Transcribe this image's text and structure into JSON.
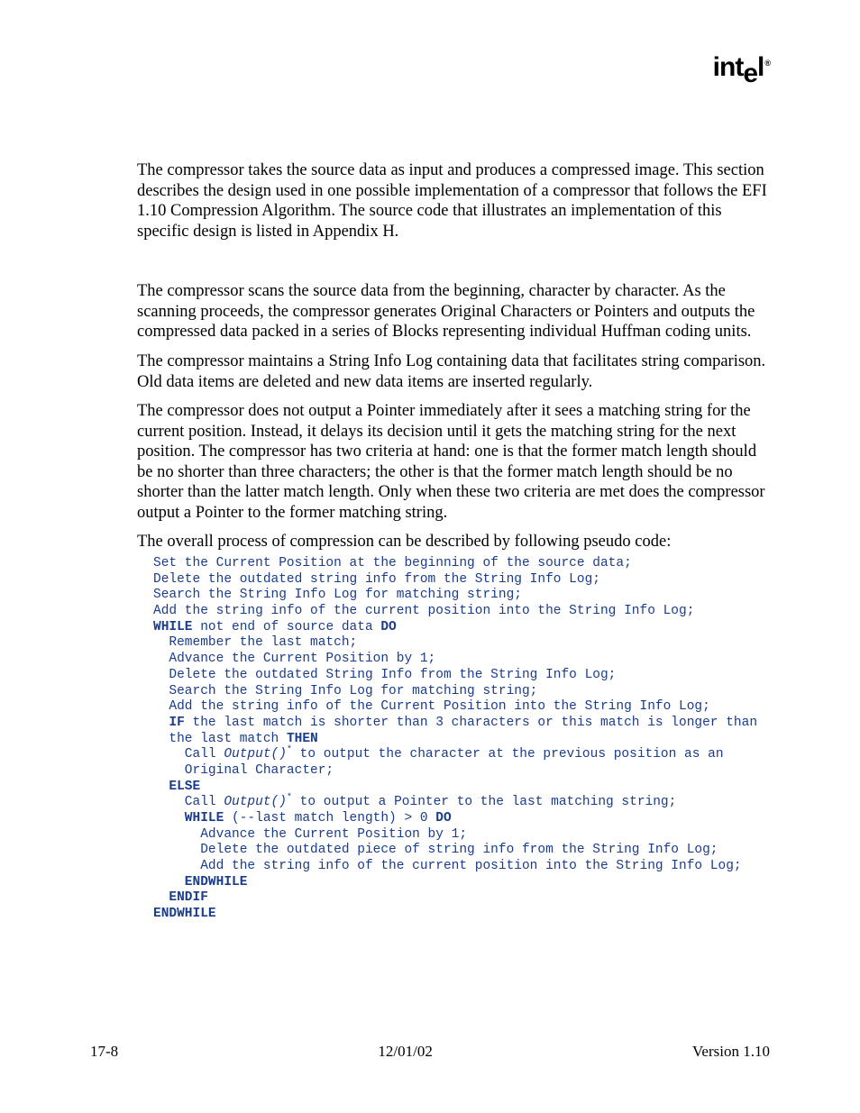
{
  "logo": {
    "text": "intel",
    "registered": "®"
  },
  "paragraphs": {
    "p1": "The compressor takes the source data as input and produces a compressed image.  This section describes the design used in one possible implementation of a compressor that follows the EFI 1.10 Compression Algorithm.  The source code that illustrates an implementation of this specific design is listed in Appendix H.",
    "p2": "The compressor scans the source data from the beginning, character by character.  As the scanning proceeds, the compressor generates Original Characters or Pointers and outputs the compressed data packed in a series of Blocks representing individual Huffman coding units.",
    "p3": "The compressor maintains a String Info Log containing data that facilitates string comparison.  Old data items are deleted and new data items are inserted regularly.",
    "p4": "The compressor does not output a Pointer immediately after it sees a matching string for the current position.  Instead, it delays its decision until it gets the matching string for the next position.  The compressor has two criteria at hand: one is that the former match length should be no shorter than three characters; the other is that the former match length should be no shorter than the latter match length.  Only when these two criteria are met does the compressor output a Pointer to the former matching string.",
    "p5": "The overall process of compression can be described by following pseudo code:"
  },
  "code": {
    "l01": "Set the Current Position at the beginning of the source data;",
    "l02": "Delete the outdated string info from the String Info Log;",
    "l03": "Search the String Info Log for matching string;",
    "l04": "Add the string info of the current position into the String Info Log;",
    "kw_while1": "WHILE",
    "l05": " not end of source data ",
    "kw_do1": "DO",
    "l06": "  Remember the last match;",
    "l07": "  Advance the Current Position by 1;",
    "l08": "  Delete the outdated String Info from the String Info Log;",
    "l09": "  Search the String Info Log for matching string;",
    "l10": "  Add the string info of the Current Position into the String Info Log;",
    "kw_if": "  IF",
    "l11a": " the last match is shorter than 3 characters or this match is longer than",
    "l11b": "  the last match ",
    "kw_then": "THEN",
    "l12a": "    Call ",
    "fn1": "Output()",
    "sup1": "*",
    "l12b": " to output the character at the previous position as an",
    "l12c": "    Original Character;",
    "kw_else": "  ELSE",
    "l13a": "    Call ",
    "fn2": "Output()",
    "sup2": "*",
    "l13b": " to output a Pointer to the last matching string;",
    "kw_while2": "    WHILE",
    "l14": " (--last match length) > 0 ",
    "kw_do2": "DO",
    "l15": "      Advance the Current Position by 1;",
    "l16": "      Delete the outdated piece of string info from the String Info Log;",
    "l17": "      Add the string info of the current position into the String Info Log;",
    "kw_endwhile1": "    ENDWHILE",
    "kw_endif": "  ENDIF",
    "kw_endwhile2": "ENDWHILE"
  },
  "footer": {
    "left": "17-8",
    "center": "12/01/02",
    "right": "Version 1.10"
  }
}
